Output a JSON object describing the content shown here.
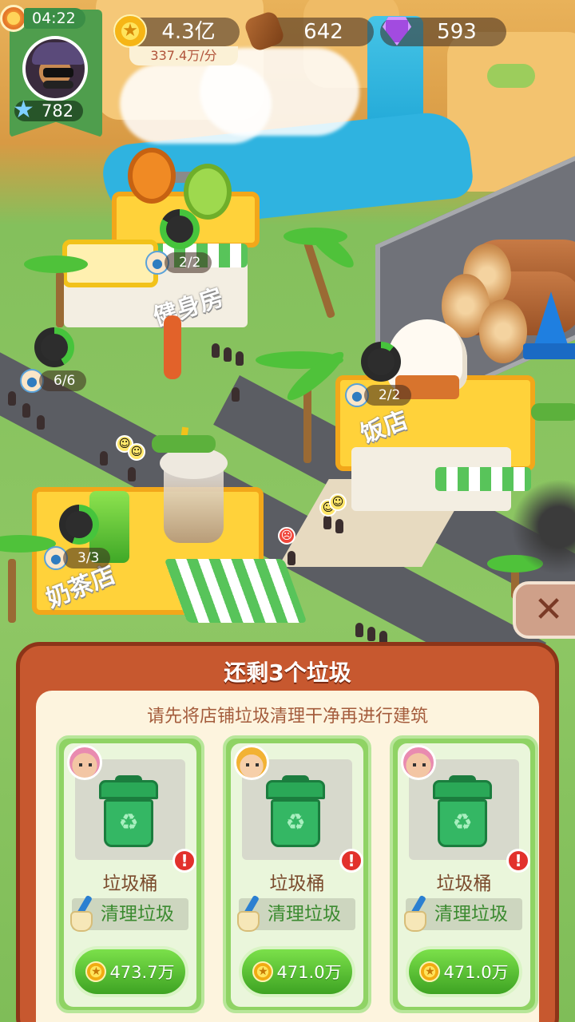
{
  "hud": {
    "clock": "04:22",
    "level": "782",
    "gold": "4.3亿",
    "gold_rate": "337.4万/分",
    "wood": "642",
    "gems": "593"
  },
  "map": {
    "gym_workers": "2/2",
    "left_workers": "6/6",
    "restaurant_workers": "2/2",
    "milktea_workers": "3/3",
    "gym_sign": "健身房",
    "restaurant_sign": "饭店",
    "milktea_sign": "奶茶店"
  },
  "dialog": {
    "title": "还剩3个垃圾",
    "subtitle": "请先将店铺垃圾清理干净再进行建筑",
    "cards": [
      {
        "name": "垃圾桶",
        "task": "清理垃圾",
        "price": "473.7万",
        "worker": "pink-hair-worker"
      },
      {
        "name": "垃圾桶",
        "task": "清理垃圾",
        "price": "471.0万",
        "worker": "blonde-worker"
      },
      {
        "name": "垃圾桶",
        "task": "清理垃圾",
        "price": "471.0万",
        "worker": "pink-hair-worker"
      }
    ]
  },
  "icons": {
    "close": "close-icon",
    "coin": "coin-icon",
    "wood": "wood-icon",
    "gem": "gem-icon",
    "star": "star-icon",
    "bin": "trash-bin-icon",
    "broom": "broom-icon",
    "alert": "alert-icon"
  },
  "colors": {
    "dialog_frame": "#c7582f",
    "dialog_body": "#fdf4de",
    "card_green": "#8fd364",
    "button_green": "#3ea323",
    "hud_green": "#4f9e4d"
  }
}
